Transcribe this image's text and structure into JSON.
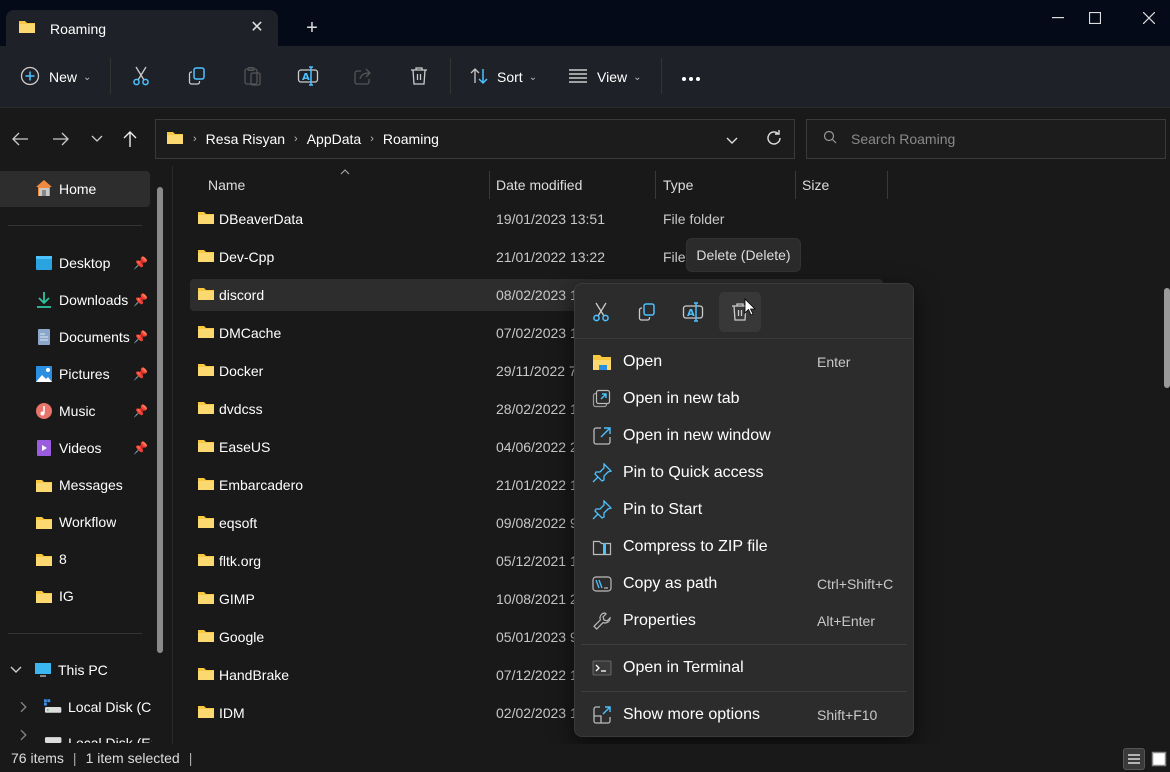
{
  "window": {
    "tab_title": "Roaming",
    "tab_icon": "folder-icon",
    "controls": [
      "minimize",
      "maximize",
      "close"
    ]
  },
  "toolbar": {
    "new_label": "New",
    "sort_label": "Sort",
    "view_label": "View",
    "icons": [
      "cut-icon",
      "copy-icon",
      "paste-icon",
      "rename-icon",
      "share-icon",
      "delete-icon",
      "more-icon"
    ]
  },
  "navigation": {
    "breadcrumb": [
      "Resa Risyan",
      "AppData",
      "Roaming"
    ],
    "search_placeholder": "Search Roaming"
  },
  "sidebar": {
    "home": "Home",
    "quick_access": [
      {
        "label": "Desktop",
        "icon": "desktop-icon",
        "pinned": true
      },
      {
        "label": "Downloads",
        "icon": "downloads-icon",
        "pinned": true
      },
      {
        "label": "Documents",
        "icon": "documents-icon",
        "pinned": true
      },
      {
        "label": "Pictures",
        "icon": "pictures-icon",
        "pinned": true
      },
      {
        "label": "Music",
        "icon": "music-icon",
        "pinned": true
      },
      {
        "label": "Videos",
        "icon": "videos-icon",
        "pinned": true
      },
      {
        "label": "Messages",
        "icon": "folder-icon",
        "pinned": false
      },
      {
        "label": "Workflow",
        "icon": "folder-icon",
        "pinned": false
      },
      {
        "label": "8",
        "icon": "folder-icon",
        "pinned": false
      },
      {
        "label": "IG",
        "icon": "folder-icon",
        "pinned": false
      }
    ],
    "this_pc": "This PC",
    "drives": [
      "Local Disk (C:",
      "Local Disk (E:"
    ]
  },
  "columns": {
    "name": "Name",
    "date": "Date modified",
    "type": "Type",
    "size": "Size"
  },
  "files": [
    {
      "name": "DBeaverData",
      "date": "19/01/2023 13:51",
      "type": "File folder"
    },
    {
      "name": "Dev-Cpp",
      "date": "21/01/2022 13:22",
      "type": "File"
    },
    {
      "name": "discord",
      "date": "08/02/2023 1",
      "type": "",
      "selected": true
    },
    {
      "name": "DMCache",
      "date": "07/02/2023 1",
      "type": ""
    },
    {
      "name": "Docker",
      "date": "29/11/2022 7",
      "type": ""
    },
    {
      "name": "dvdcss",
      "date": "28/02/2022 1",
      "type": ""
    },
    {
      "name": "EaseUS",
      "date": "04/06/2022 2",
      "type": ""
    },
    {
      "name": "Embarcadero",
      "date": "21/01/2022 1",
      "type": ""
    },
    {
      "name": "eqsoft",
      "date": "09/08/2022 9",
      "type": ""
    },
    {
      "name": "fltk.org",
      "date": "05/12/2021 1",
      "type": ""
    },
    {
      "name": "GIMP",
      "date": "10/08/2021 2",
      "type": ""
    },
    {
      "name": "Google",
      "date": "05/01/2023 9",
      "type": ""
    },
    {
      "name": "HandBrake",
      "date": "07/12/2022 1",
      "type": ""
    },
    {
      "name": "IDM",
      "date": "02/02/2023 1",
      "type": ""
    }
  ],
  "tooltip": "Delete (Delete)",
  "context_menu": {
    "quick_actions": [
      "cut-icon",
      "copy-icon",
      "rename-icon",
      "delete-icon"
    ],
    "items": [
      {
        "label": "Open",
        "shortcut": "Enter",
        "icon": "folder-open-icon"
      },
      {
        "label": "Open in new tab",
        "shortcut": "",
        "icon": "new-tab-icon"
      },
      {
        "label": "Open in new window",
        "shortcut": "",
        "icon": "new-window-icon"
      },
      {
        "label": "Pin to Quick access",
        "shortcut": "",
        "icon": "pin-icon"
      },
      {
        "label": "Pin to Start",
        "shortcut": "",
        "icon": "pin-icon"
      },
      {
        "label": "Compress to ZIP file",
        "shortcut": "",
        "icon": "zip-icon"
      },
      {
        "label": "Copy as path",
        "shortcut": "Ctrl+Shift+C",
        "icon": "copy-path-icon"
      },
      {
        "label": "Properties",
        "shortcut": "Alt+Enter",
        "icon": "wrench-icon"
      },
      {
        "label": "Open in Terminal",
        "shortcut": "",
        "icon": "terminal-icon"
      },
      {
        "label": "Show more options",
        "shortcut": "Shift+F10",
        "icon": "more-options-icon"
      }
    ]
  },
  "status": {
    "count": "76 items",
    "selection": "1 item selected"
  },
  "colors": {
    "accent": "#4cc2ff",
    "folder": "#f8c840",
    "titlebar": "#040a18",
    "toolbar": "#1f2128",
    "background": "#191919",
    "menu": "#2c2c2c"
  }
}
